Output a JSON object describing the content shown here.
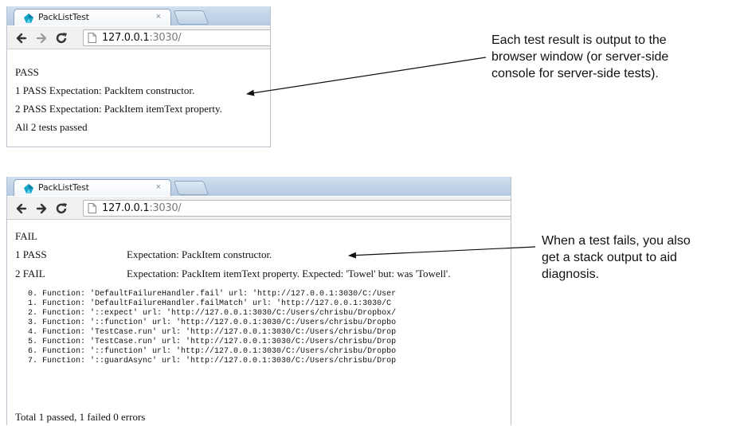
{
  "top_browser": {
    "tab_title": "PackListTest",
    "tab_close": "×",
    "url_host": "127.0.0.1",
    "url_port": ":3030/",
    "results": {
      "header": "PASS",
      "line1": "1 PASS Expectation: PackItem constructor.",
      "line2": "2 PASS Expectation: PackItem itemText property.",
      "summary": "All 2 tests passed"
    }
  },
  "bottom_browser": {
    "tab_title": "PackListTest",
    "tab_close": "×",
    "url_host": "127.0.0.1",
    "url_port": ":3030/",
    "results": {
      "header": "FAIL",
      "row1_status": "1 PASS",
      "row1_text": "Expectation: PackItem constructor.",
      "row2_status": "2 FAIL",
      "row2_text": "Expectation: PackItem itemText property. Expected: 'Towel' but: was 'Towell'.",
      "stack": [
        "0. Function: 'DefaultFailureHandler.fail' url: 'http://127.0.0.1:3030/C:/User",
        "1. Function: 'DefaultFailureHandler.failMatch' url: 'http://127.0.0.1:3030/C",
        "2. Function: '::expect' url: 'http://127.0.0.1:3030/C:/Users/chrisbu/Dropbox/",
        "3. Function: '::function' url: 'http://127.0.0.1:3030/C:/Users/chrisbu/Dropbo",
        "4. Function: 'TestCase.run' url: 'http://127.0.0.1:3030/C:/Users/chrisbu/Drop",
        "5. Function: 'TestCase.run' url: 'http://127.0.0.1:3030/C:/Users/chrisbu/Drop",
        "6. Function: '::function' url: 'http://127.0.0.1:3030/C:/Users/chrisbu/Dropbo",
        "7. Function: '::guardAsync' url: 'http://127.0.0.1:3030/C:/Users/chrisbu/Drop"
      ],
      "summary": "Total 1 passed, 1 failed 0 errors"
    }
  },
  "annotations": {
    "top": [
      "Each test result is output to the",
      "browser window (or server-side",
      "console for server-side tests)."
    ],
    "bottom": [
      "When a test fails, you also",
      "get a stack output to aid",
      "diagnosis."
    ]
  },
  "icons": {
    "favicon": "dart-favicon-icon",
    "back": "back-arrow-icon",
    "forward": "forward-arrow-icon",
    "reload": "reload-icon",
    "page": "page-icon"
  },
  "colors": {
    "tabstrip": "#c4d6ea",
    "favicon": "#17a6c8",
    "url_port": "#7a7a7a"
  }
}
